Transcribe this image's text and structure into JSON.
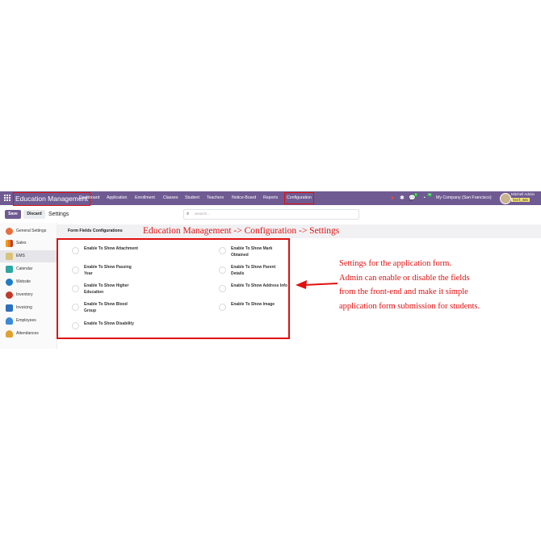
{
  "navbar": {
    "app_title": "Education Management",
    "menu": [
      "Dashboard",
      "Application",
      "Enrollment",
      "Classes",
      "Student",
      "Teachers",
      "Notice-Board",
      "Reports",
      "Configuration"
    ],
    "company": "My Company (San Francisco)",
    "user_name": "Mitchell Admin",
    "db_name": "test_ems",
    "chat_badge": "5",
    "activity_badge": "36",
    "colors": {
      "navbar": "#6f5b92",
      "highlight": "#e01010"
    }
  },
  "control": {
    "save_label": "Save",
    "discard_label": "Discard",
    "page_title": "Settings",
    "search_placeholder": "Search..."
  },
  "sidebar": {
    "items": [
      {
        "label": "General Settings",
        "icon": "gear-icon"
      },
      {
        "label": "Sales",
        "icon": "sales-icon"
      },
      {
        "label": "EMS",
        "icon": "ems-icon"
      },
      {
        "label": "Calendar",
        "icon": "calendar-icon"
      },
      {
        "label": "Website",
        "icon": "website-icon"
      },
      {
        "label": "Inventory",
        "icon": "inventory-icon"
      },
      {
        "label": "Invoicing",
        "icon": "invoicing-icon"
      },
      {
        "label": "Employees",
        "icon": "employees-icon"
      },
      {
        "label": "Attendances",
        "icon": "attendances-icon"
      }
    ]
  },
  "section": {
    "title": "Form Fields Configurations",
    "annotation": "Education Management -> Configuration -> Settings"
  },
  "options": [
    {
      "label": "Enable To Show Attachment",
      "checked": false
    },
    {
      "label": "Enable To Show Mark Obtained",
      "checked": false
    },
    {
      "label": "Enable To Show Passing Year",
      "checked": false
    },
    {
      "label": "Enable To Show Parent Details",
      "checked": false
    },
    {
      "label": "Enable To Show Higher Education",
      "checked": false
    },
    {
      "label": "Enable To Show Address Info",
      "checked": false
    },
    {
      "label": "Enable To Show Blood Group",
      "checked": false
    },
    {
      "label": "Enable To Show Image",
      "checked": false
    },
    {
      "label": "Enable To Show Disability",
      "checked": false
    }
  ],
  "annotation": {
    "lines": [
      "Settings for the application form.",
      "Admin can enable or disable the fields",
      "from the front-end and make it simple",
      "application form submission for students."
    ]
  }
}
